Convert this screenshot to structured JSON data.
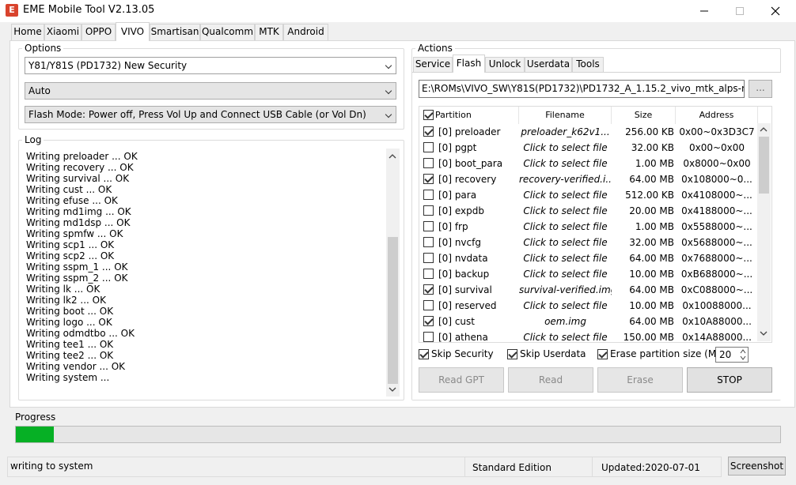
{
  "window": {
    "title": "EME Mobile Tool V2.13.05",
    "app_icon": "E",
    "colors": {
      "accent": "#d9432d",
      "progress": "#06b025"
    }
  },
  "main_tabs": [
    "Home",
    "Xiaomi",
    "OPPO",
    "VIVO",
    "Smartisan",
    "Qualcomm",
    "MTK",
    "Android"
  ],
  "main_tab_selected": "VIVO",
  "options": {
    "label": "Options",
    "model": "Y81/Y81S (PD1732) New Security",
    "mode": "Auto",
    "flash_mode": "Flash Mode: Power off, Press Vol Up and Connect USB Cable (or Vol Dn)"
  },
  "log": {
    "label": "Log",
    "lines": [
      "Writing preloader ... OK",
      "Writing recovery ... OK",
      "Writing survival ... OK",
      "Writing cust ... OK",
      "Writing efuse ... OK",
      "Writing md1img ... OK",
      "Writing md1dsp ... OK",
      "Writing spmfw ... OK",
      "Writing scp1 ... OK",
      "Writing scp2 ... OK",
      "Writing sspm_1 ... OK",
      "Writing sspm_2 ... OK",
      "Writing lk ... OK",
      "Writing lk2 ... OK",
      "Writing boot ... OK",
      "Writing logo ... OK",
      "Writing odmdtbo ... OK",
      "Writing tee1 ... OK",
      "Writing tee2 ... OK",
      "Writing vendor ... OK",
      "Writing system ..."
    ]
  },
  "actions": {
    "label": "Actions",
    "tabs": [
      "Service",
      "Flash",
      "Unlock",
      "Userdata",
      "Tools"
    ],
    "tab_selected": "Flash",
    "path": "E:\\ROMs\\VIVO_SW\\Y81S(PD1732)\\PD1732_A_1.15.2_vivo_mtk_alps-rele",
    "browse_label": "...",
    "table": {
      "headers": [
        "Partition",
        "Filename",
        "Size",
        "Address"
      ],
      "rows": [
        {
          "checked": true,
          "partition": "[0] preloader",
          "filename": "preloader_k62v1...",
          "size": "256.00 KB",
          "address": "0x00~0x3D3C7"
        },
        {
          "checked": false,
          "partition": "[0] pgpt",
          "filename": "Click to select file",
          "size": "32.00 KB",
          "address": "0x00~0x00"
        },
        {
          "checked": false,
          "partition": "[0] boot_para",
          "filename": "Click to select file",
          "size": "1.00 MB",
          "address": "0x8000~0x00"
        },
        {
          "checked": true,
          "partition": "[0] recovery",
          "filename": "recovery-verified.i...",
          "size": "64.00 MB",
          "address": "0x108000~0..."
        },
        {
          "checked": false,
          "partition": "[0] para",
          "filename": "Click to select file",
          "size": "512.00 KB",
          "address": "0x4108000~..."
        },
        {
          "checked": false,
          "partition": "[0] expdb",
          "filename": "Click to select file",
          "size": "20.00 MB",
          "address": "0x4188000~..."
        },
        {
          "checked": false,
          "partition": "[0] frp",
          "filename": "Click to select file",
          "size": "1.00 MB",
          "address": "0x5588000~..."
        },
        {
          "checked": false,
          "partition": "[0] nvcfg",
          "filename": "Click to select file",
          "size": "32.00 MB",
          "address": "0x5688000~..."
        },
        {
          "checked": false,
          "partition": "[0] nvdata",
          "filename": "Click to select file",
          "size": "64.00 MB",
          "address": "0x7688000~..."
        },
        {
          "checked": false,
          "partition": "[0] backup",
          "filename": "Click to select file",
          "size": "10.00 MB",
          "address": "0xB688000~..."
        },
        {
          "checked": true,
          "partition": "[0] survival",
          "filename": "survival-verified.img",
          "size": "64.00 MB",
          "address": "0xC088000~..."
        },
        {
          "checked": false,
          "partition": "[0] reserved",
          "filename": "Click to select file",
          "size": "10.00 MB",
          "address": "0x10088000..."
        },
        {
          "checked": true,
          "partition": "[0] cust",
          "filename": "oem.img",
          "size": "64.00 MB",
          "address": "0x10A88000..."
        },
        {
          "checked": false,
          "partition": "[0] athena",
          "filename": "Click to select file",
          "size": "150.00 MB",
          "address": "0x14A88000..."
        }
      ]
    },
    "skip_security": "Skip Security",
    "skip_userdata": "Skip Userdata",
    "erase_partition_size": "Erase partition size (MB)",
    "erase_size_value": "20",
    "buttons": {
      "read_gpt": "Read GPT",
      "read": "Read",
      "erase": "Erase",
      "stop": "STOP"
    }
  },
  "progress": {
    "label": "Progress",
    "percent": 5
  },
  "status": {
    "message": "writing to system",
    "edition": "Standard Edition",
    "updated": "Updated:2020-07-01",
    "screenshot_button": "Screenshot"
  }
}
